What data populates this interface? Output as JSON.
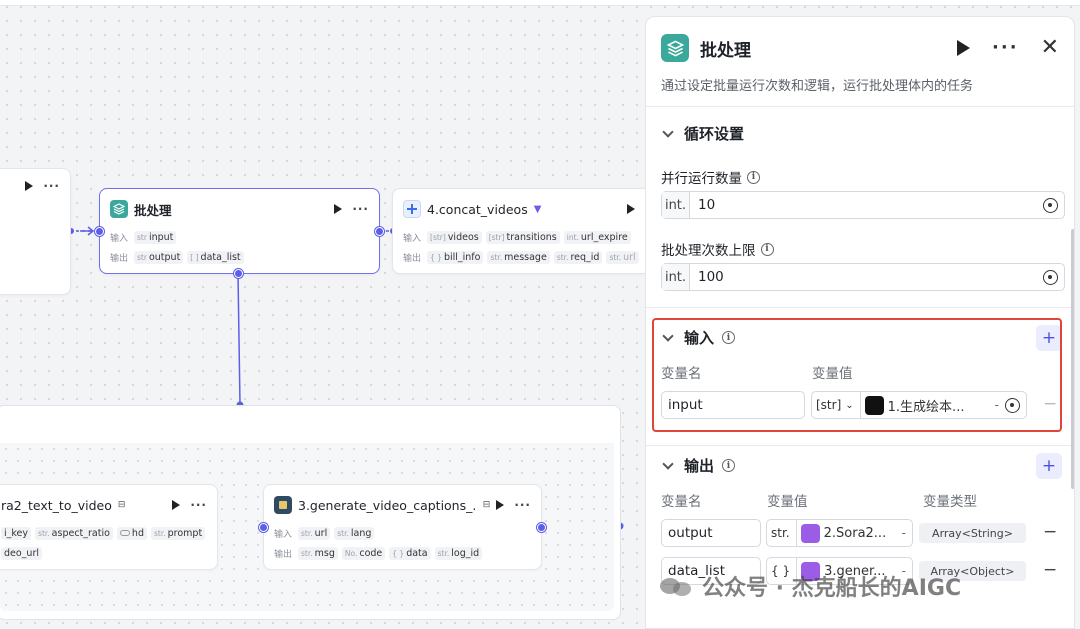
{
  "canvas": {
    "left_node": {},
    "batch_node": {
      "title": "批处理",
      "input_label": "输入",
      "output_label": "输出",
      "inputs": [
        {
          "type": "str",
          "name": "input"
        }
      ],
      "outputs": [
        {
          "type": "str",
          "name": "output"
        },
        {
          "type": "[ ]",
          "name": "data_list"
        }
      ]
    },
    "concat_node": {
      "title": "4.concat_videos",
      "input_label": "输入",
      "output_label": "输出",
      "inputs": [
        {
          "type": "[str]",
          "name": "videos"
        },
        {
          "type": "[str]",
          "name": "transitions"
        },
        {
          "type": "int.",
          "name": "url_expire"
        }
      ],
      "outputs": [
        {
          "type": "{ }",
          "name": "bill_info"
        },
        {
          "type": "str.",
          "name": "message"
        },
        {
          "type": "str.",
          "name": "req_id"
        },
        {
          "type": "str.",
          "name": "url"
        }
      ]
    },
    "sora_node": {
      "title": "ra2_text_to_video",
      "row1": [
        {
          "type": "",
          "name": "i_key"
        },
        {
          "type": "str.",
          "name": "aspect_ratio"
        },
        {
          "type": "toggle",
          "name": "hd"
        },
        {
          "type": "str.",
          "name": "prompt"
        }
      ],
      "row2": [
        {
          "type": "",
          "name": "deo_url"
        }
      ]
    },
    "captions_node": {
      "title": "3.generate_video_captions_...",
      "input_label": "输入",
      "output_label": "输出",
      "inputs": [
        {
          "type": "str.",
          "name": "url"
        },
        {
          "type": "str.",
          "name": "lang"
        }
      ],
      "outputs": [
        {
          "type": "str.",
          "name": "msg"
        },
        {
          "type": "No.",
          "name": "code"
        },
        {
          "type": "{ }",
          "name": "data"
        },
        {
          "type": "str.",
          "name": "log_id"
        }
      ]
    }
  },
  "panel": {
    "title": "批处理",
    "description": "通过设定批量运行次数和逻辑，运行批处理体内的任务",
    "loop_section": {
      "title": "循环设置",
      "concurrency_label": "并行运行数量",
      "concurrency_prefix": "int.",
      "concurrency_value": "10",
      "max_label": "批处理次数上限",
      "max_prefix": "int.",
      "max_value": "100"
    },
    "input_section": {
      "title": "输入",
      "col_name": "变量名",
      "col_value": "变量值",
      "rows": [
        {
          "name": "input",
          "type": "[str]",
          "ref": "1.生成绘本...",
          "ref_suffix": "-"
        }
      ]
    },
    "output_section": {
      "title": "输出",
      "col_name": "变量名",
      "col_value": "变量值",
      "col_type": "变量类型",
      "rows": [
        {
          "name": "output",
          "type": "str.",
          "ref": "2.Sora2...",
          "ref_suffix": "-",
          "var_type": "Array<String>"
        },
        {
          "name": "data_list",
          "type": "{ }",
          "ref": "3.gener...",
          "ref_suffix": "-",
          "var_type": "Array<Object>"
        }
      ]
    }
  },
  "watermark": {
    "text": "公众号 · 杰克船长的AIGC"
  },
  "colors": {
    "accent": "#5b5ee8",
    "batch_icon": "#3aa89a",
    "highlight": "#e0453a"
  }
}
